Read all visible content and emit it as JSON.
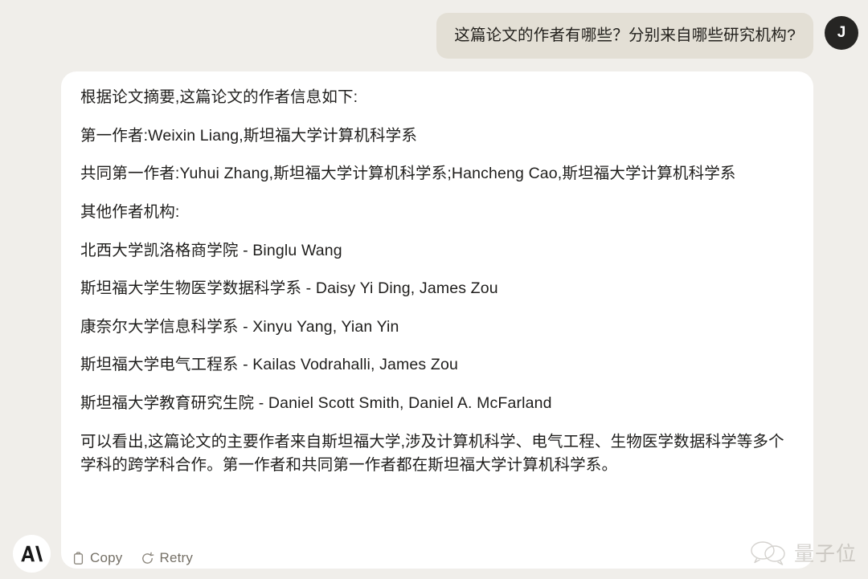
{
  "colors": {
    "page_background": "#f0eeea",
    "card_background": "#ffffff",
    "user_bubble_background": "#e3dfd5",
    "avatar_background": "#262523",
    "text_primary": "#1f1e1c",
    "action_text": "#757066",
    "watermark": "#9a968d"
  },
  "user_turn": {
    "message": "这篇论文的作者有哪些？分别来自哪些研究机构?",
    "avatar_initial": "J",
    "avatar_icon": "user-avatar"
  },
  "assistant_turn": {
    "paragraphs": [
      "根据论文摘要,这篇论文的作者信息如下:",
      "第一作者:Weixin Liang,斯坦福大学计算机科学系",
      "共同第一作者:Yuhui Zhang,斯坦福大学计算机科学系;Hancheng Cao,斯坦福大学计算机科学系",
      "其他作者机构:",
      "北西大学凯洛格商学院 - Binglu Wang",
      "斯坦福大学生物医学数据科学系 - Daisy Yi Ding, James Zou",
      "康奈尔大学信息科学系 - Xinyu Yang, Yian Yin",
      "斯坦福大学电气工程系 - Kailas Vodrahalli, James Zou",
      "斯坦福大学教育研究生院 - Daniel Scott Smith, Daniel A. McFarland",
      "可以看出,这篇论文的主要作者来自斯坦福大学,涉及计算机科学、电气工程、生物医学数据科学等多个学科的跨学科合作。第一作者和共同第一作者都在斯坦福大学计算机科学系。"
    ],
    "actions": {
      "copy_label": "Copy",
      "copy_icon": "clipboard-icon",
      "retry_label": "Retry",
      "retry_icon": "refresh-icon"
    },
    "brand_icon": "anthropic-logo"
  },
  "watermark": {
    "text": "量子位",
    "icon": "wechat-bubbles-icon"
  }
}
